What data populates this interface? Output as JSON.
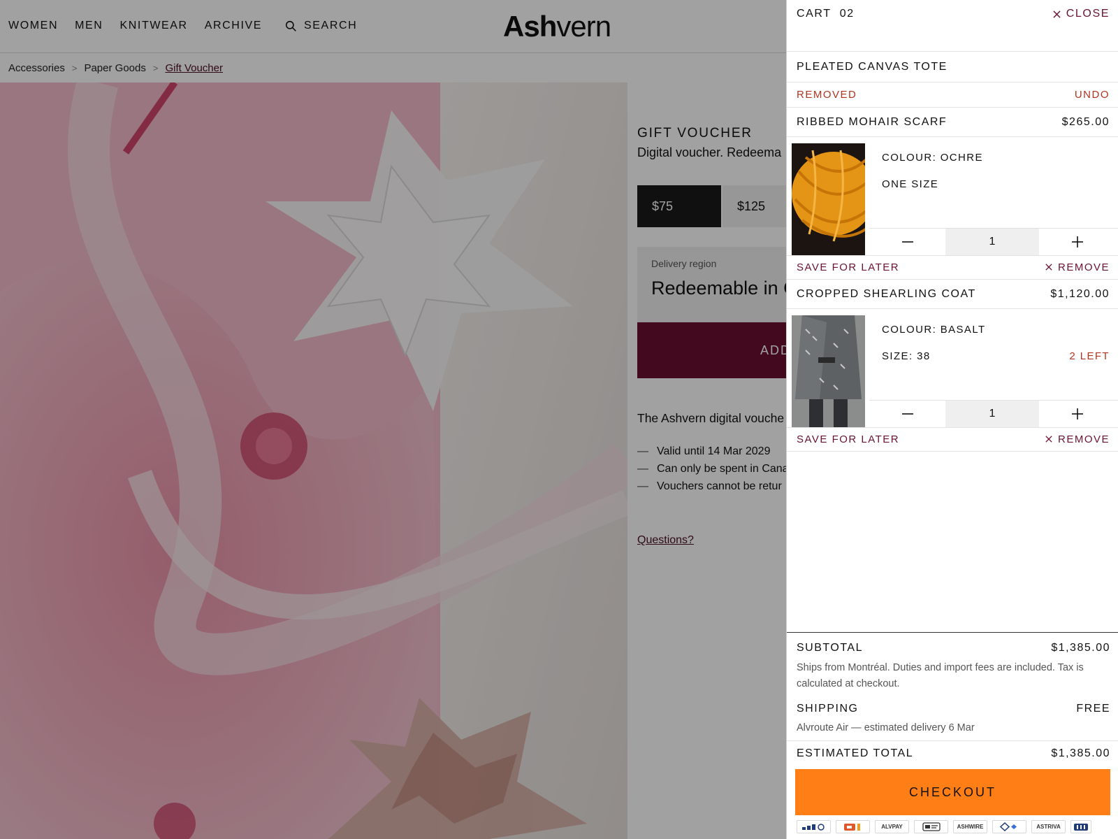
{
  "header": {
    "nav": [
      "WOMEN",
      "MEN",
      "KNITWEAR",
      "ARCHIVE"
    ],
    "search_label": "SEARCH",
    "logo_bold": "Ash",
    "logo_light": "vern"
  },
  "breadcrumb": [
    "Accessories",
    "Paper Goods",
    "Gift Voucher"
  ],
  "breadcrumb_sep": ">",
  "product": {
    "title": "GIFT VOUCHER",
    "subtitle": "Digital voucher. Redeema",
    "amounts": [
      "$75",
      "$125"
    ],
    "selected_amount": "$75",
    "region_label": "Delivery region",
    "region_value": "Redeemable in C",
    "add_label": "ADD",
    "description": "The Ashvern digital vouche piece, online or in our bouti",
    "bullets": [
      "Valid until 14 Mar 2029",
      "Can only be spent in Cana",
      "Vouchers cannot be retur"
    ],
    "questions": "Questions?"
  },
  "cart": {
    "title": "CART",
    "count": "02",
    "close_label": "CLOSE",
    "removed_item": {
      "name": "PLEATED CANVAS TOTE",
      "status": "REMOVED",
      "undo": "UNDO"
    },
    "items": [
      {
        "name": "RIBBED MOHAIR SCARF",
        "price": "$265.00",
        "colour": "COLOUR: OCHRE",
        "size": "ONE SIZE",
        "qty": "1",
        "stock": "",
        "thumb_icon": "yarn-image"
      },
      {
        "name": "CROPPED SHEARLING COAT",
        "price": "$1,120.00",
        "colour": "COLOUR: BASALT",
        "size": "SIZE: 38",
        "qty": "1",
        "stock": "2 LEFT",
        "thumb_icon": "coat-image"
      }
    ],
    "save_label": "SAVE FOR LATER",
    "remove_label": "REMOVE",
    "subtotal_label": "SUBTOTAL",
    "subtotal": "$1,385.00",
    "subtotal_note": "Ships from Montréal. Duties and import fees are included. Tax is calculated at checkout.",
    "shipping_label": "SHIPPING",
    "shipping_value": "FREE",
    "shipping_note": "Alvroute Air — estimated delivery 6 Mar",
    "total_label": "ESTIMATED TOTAL",
    "total": "$1,385.00",
    "checkout_label": "CHECKOUT",
    "payments": [
      "ALVPAY",
      "ASHWIRE",
      "ASTRIVA"
    ],
    "colors": {
      "accent": "#6b1230",
      "checkout": "#ff7f16",
      "alert": "#b0351f"
    }
  }
}
